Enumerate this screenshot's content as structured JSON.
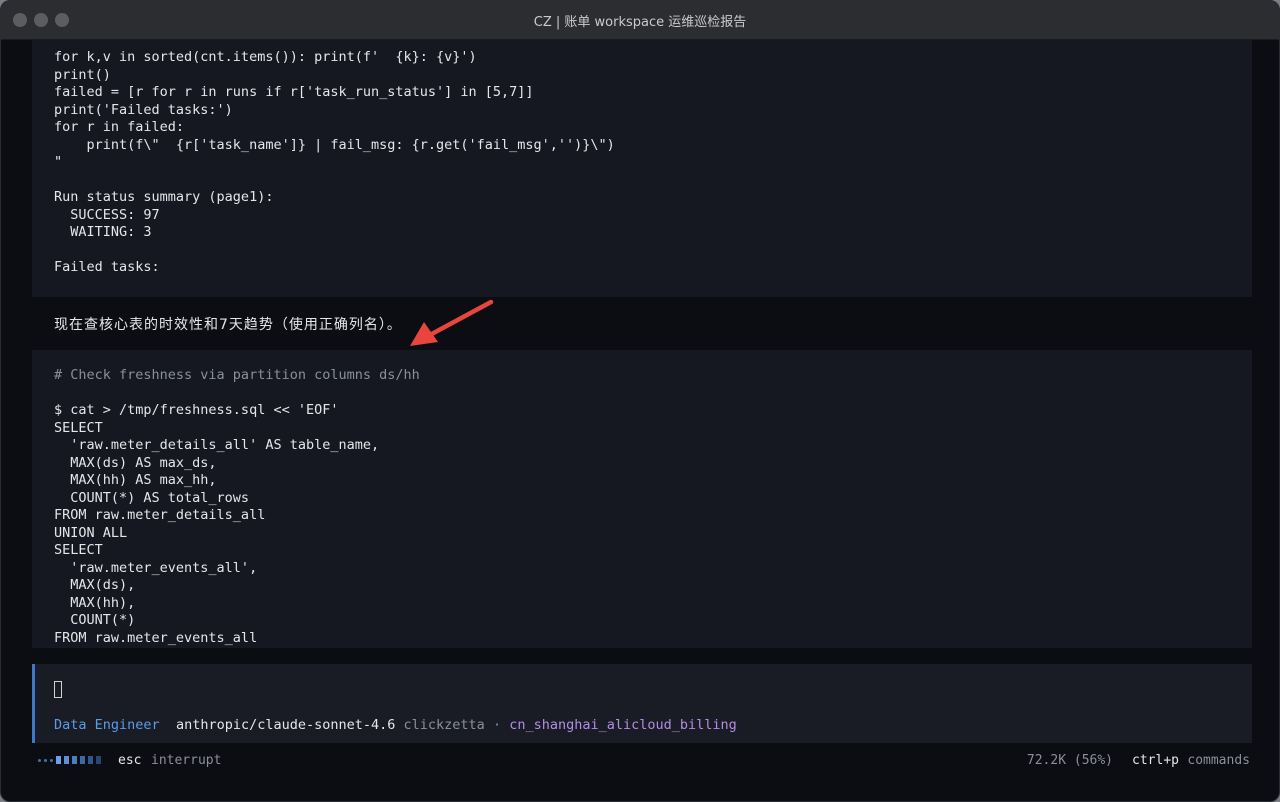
{
  "window": {
    "title": "CZ | 账单 workspace 运维巡检报告"
  },
  "transcript": {
    "output_block": [
      "for k,v in sorted(cnt.items()): print(f'  {k}: {v}')",
      "print()",
      "failed = [r for r in runs if r['task_run_status'] in [5,7]]",
      "print('Failed tasks:')",
      "for r in failed:",
      "    print(f\\\"  {r['task_name']} | fail_msg: {r.get('fail_msg','')}\\\")",
      "\"",
      "",
      "Run status summary (page1):",
      "  SUCCESS: 97",
      "  WAITING: 3",
      "",
      "Failed tasks:"
    ],
    "assistant_message": "现在查核心表的时效性和7天趋势（使用正确列名）。",
    "command_block": {
      "comment": "# Check freshness via partition columns ds/hh",
      "lines": [
        "",
        "$ cat > /tmp/freshness.sql << 'EOF'",
        "SELECT",
        "  'raw.meter_details_all' AS table_name,",
        "  MAX(ds) AS max_ds,",
        "  MAX(hh) AS max_hh,",
        "  COUNT(*) AS total_rows",
        "FROM raw.meter_details_all",
        "UNION ALL",
        "SELECT",
        "  'raw.meter_events_all',",
        "  MAX(ds),",
        "  MAX(hh),",
        "  COUNT(*)",
        "FROM raw.meter_events_all"
      ]
    }
  },
  "prompt": {
    "agent": "Data Engineer",
    "model": "anthropic/claude-sonnet-4.6",
    "provider": "clickzetta",
    "separator": "·",
    "workspace": "cn_shanghai_alicloud_billing"
  },
  "statusbar": {
    "esc_key": "esc",
    "esc_label": "interrupt",
    "tokens": "72.2K (56%)",
    "cmd_key": "ctrl+p",
    "cmd_label": "commands"
  },
  "colors": {
    "accent": "#3d78c9",
    "agent": "#5a9ce8",
    "workspace": "#b58be6",
    "annotation_arrow": "#e8453c"
  }
}
